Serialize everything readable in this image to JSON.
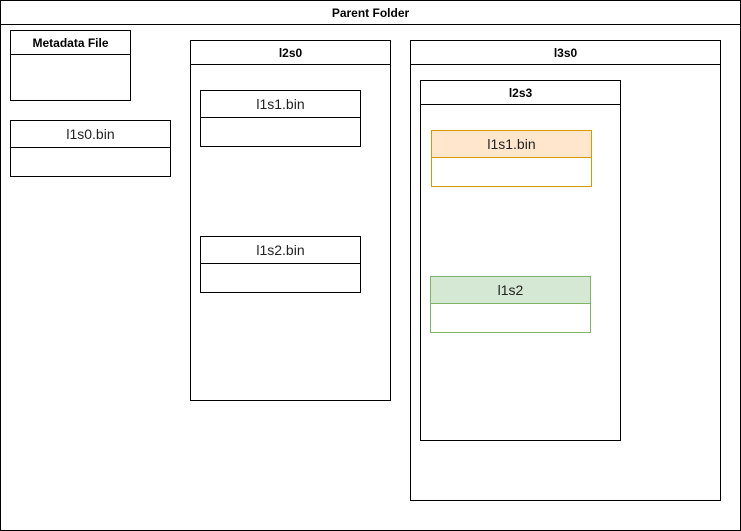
{
  "parent_folder": {
    "title": "Parent Folder"
  },
  "metadata_file": {
    "title": "Metadata File"
  },
  "root_file": {
    "title": "l1s0.bin"
  },
  "l2s0": {
    "title": "l2s0",
    "files": [
      {
        "title": "l1s1.bin"
      },
      {
        "title": "l1s2.bin"
      }
    ]
  },
  "l3s0": {
    "title": "l3s0",
    "l2s3": {
      "title": "l2s3",
      "files": [
        {
          "title": "l1s1.bin",
          "fill": "#ffe6cc",
          "stroke": "#d79b00"
        },
        {
          "title": "l1s2",
          "fill": "#d5e8d4",
          "stroke": "#82b366"
        }
      ]
    }
  }
}
